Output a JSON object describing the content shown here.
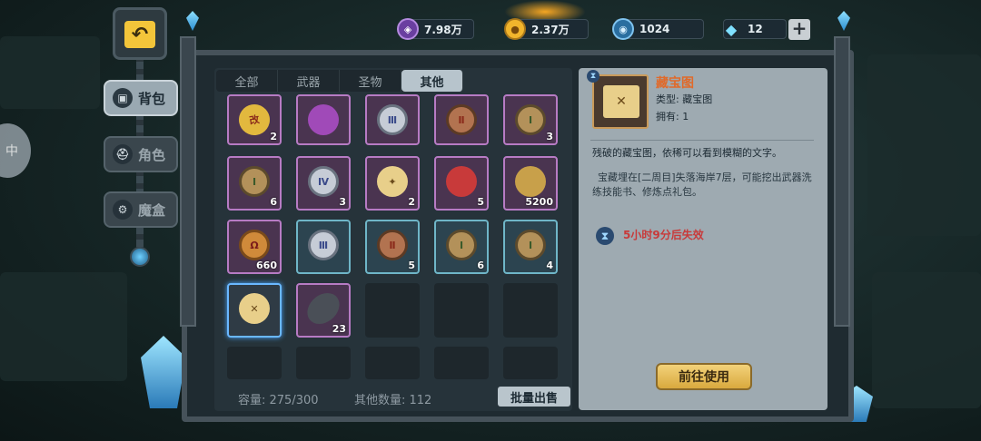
{
  "resources": [
    {
      "icon": "purple-gem-icon",
      "label": "7.98万",
      "color": "#9b6ad0"
    },
    {
      "icon": "gold-coin-icon",
      "label": "2.37万",
      "color": "#f2b52c"
    },
    {
      "icon": "blue-orb-icon",
      "label": "1024",
      "color": "#4aa0d8"
    },
    {
      "icon": "diamond-icon",
      "label": "12",
      "color": "#7fe0ff"
    }
  ],
  "resource_add_label": "+",
  "nav": [
    {
      "label": "背包",
      "icon": "bag-icon",
      "active": true
    },
    {
      "label": "角色",
      "icon": "helmet-icon",
      "active": false
    },
    {
      "label": "魔盒",
      "icon": "magic-box-icon",
      "active": false
    }
  ],
  "side_button_label": "中",
  "tabs": [
    {
      "label": "全部",
      "active": false
    },
    {
      "label": "武器",
      "active": false
    },
    {
      "label": "圣物",
      "active": false
    },
    {
      "label": "其他",
      "active": true
    }
  ],
  "inventory": [
    {
      "kind": "ticket",
      "glyph": "改",
      "count": "2",
      "frame": "item"
    },
    {
      "kind": "potion",
      "glyph": "",
      "count": "",
      "frame": "item"
    },
    {
      "kind": "coin-s",
      "glyph": "Ⅲ",
      "count": "",
      "frame": "item"
    },
    {
      "kind": "coin-r",
      "glyph": "Ⅱ",
      "count": "",
      "frame": "item"
    },
    {
      "kind": "coin-g",
      "glyph": "Ⅰ",
      "count": "3",
      "frame": "item"
    },
    {
      "kind": "coin-g",
      "glyph": "Ⅰ",
      "count": "6",
      "frame": "item"
    },
    {
      "kind": "coin-s",
      "glyph": "Ⅳ",
      "count": "3",
      "frame": "item"
    },
    {
      "kind": "scroll",
      "glyph": "✦",
      "count": "2",
      "frame": "item"
    },
    {
      "kind": "redpack",
      "glyph": "",
      "count": "5",
      "frame": "item"
    },
    {
      "kind": "pouch",
      "glyph": "",
      "count": "5200",
      "frame": "item"
    },
    {
      "kind": "coin-o",
      "glyph": "Ω",
      "count": "660",
      "frame": "item"
    },
    {
      "kind": "coin-s",
      "glyph": "Ⅲ",
      "count": "",
      "frame": "blue"
    },
    {
      "kind": "coin-r",
      "glyph": "Ⅱ",
      "count": "5",
      "frame": "blue"
    },
    {
      "kind": "coin-g",
      "glyph": "Ⅰ",
      "count": "6",
      "frame": "blue"
    },
    {
      "kind": "coin-g",
      "glyph": "Ⅰ",
      "count": "4",
      "frame": "blue"
    },
    {
      "kind": "scroll",
      "glyph": "✕",
      "count": "",
      "frame": "sel"
    },
    {
      "kind": "ingot",
      "glyph": "",
      "count": "23",
      "frame": "item"
    }
  ],
  "capacity_label": "容量: 275/300",
  "other_count_label": "其他数量: 112",
  "bulk_sell_label": "批量出售",
  "detail": {
    "name": "藏宝图",
    "type_line": "类型: 藏宝图",
    "own_line": "拥有: 1",
    "description": "残破的藏宝图，依稀可以看到模糊的文字。",
    "detail_text": "宝藏埋在[二周目]失落海岸7层，可能挖出武器洗练技能书、修炼点礼包。",
    "expire_text": "5小时9分后失效",
    "use_button_label": "前往使用"
  }
}
